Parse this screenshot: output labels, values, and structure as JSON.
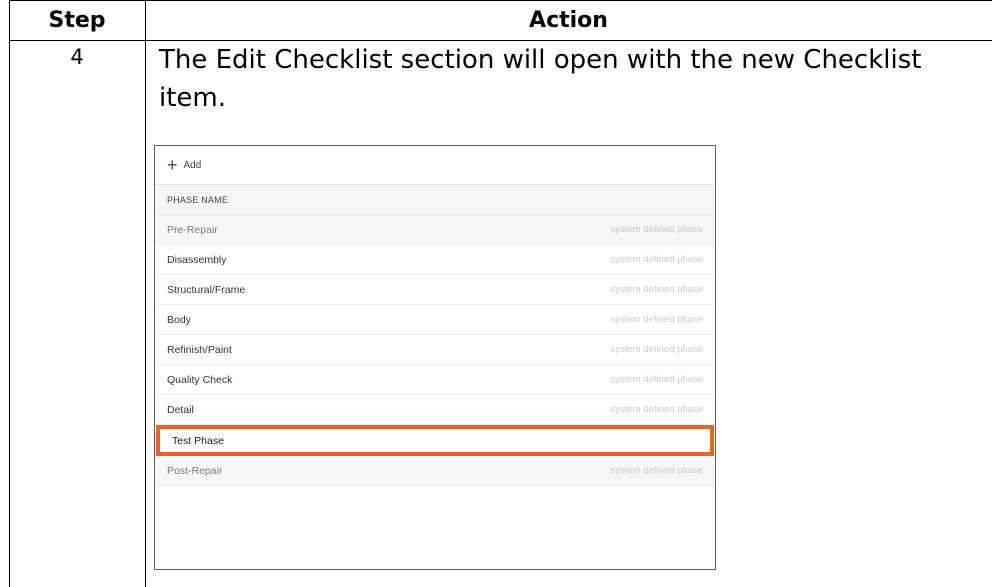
{
  "table": {
    "header_step": "Step",
    "header_action": "Action",
    "step_number": "4",
    "action_line1": "The Edit Checklist section will open with the new Checklist",
    "action_line2": "item."
  },
  "screenshot": {
    "add_label": "Add",
    "column_header": "PHASE NAME",
    "rows": [
      {
        "name": "Pre-Repair",
        "tag": "system defined phase"
      },
      {
        "name": "Disassembly",
        "tag": "system defined phase"
      },
      {
        "name": "Structural/Frame",
        "tag": "system defined phase"
      },
      {
        "name": "Body",
        "tag": "system defined phase"
      },
      {
        "name": "Refinish/Paint",
        "tag": "system defined phase"
      },
      {
        "name": "Quality Check",
        "tag": "system defined phase"
      },
      {
        "name": "Detail",
        "tag": "system defined phase"
      },
      {
        "name": "Test Phase",
        "tag": ""
      },
      {
        "name": "Post-Repair",
        "tag": "system defined phase"
      }
    ],
    "highlight_color": "#e8651c"
  }
}
